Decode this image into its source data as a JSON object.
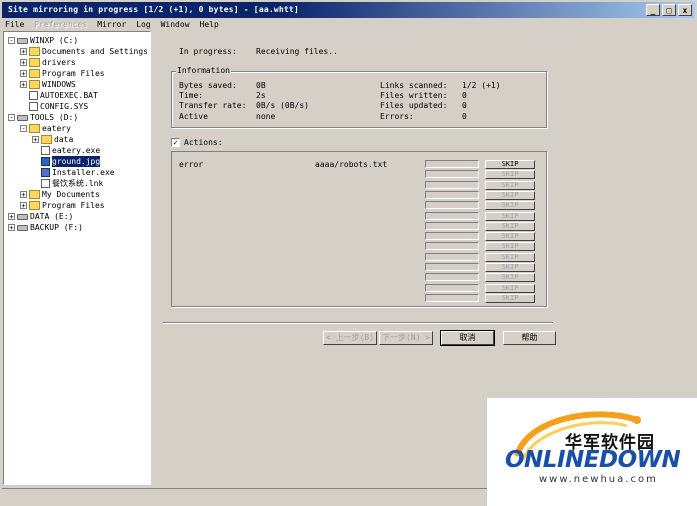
{
  "window": {
    "title": "Site mirroring in progress [1/2 (+1), 0 bytes] - [aa.whtt]",
    "buttons": {
      "minimize": "_",
      "maximize": "□",
      "close": "x"
    }
  },
  "menu": [
    {
      "label": "File",
      "disabled": false
    },
    {
      "label": "Preferences",
      "disabled": true
    },
    {
      "label": "Mirror",
      "disabled": false
    },
    {
      "label": "Log",
      "disabled": false
    },
    {
      "label": "Window",
      "disabled": false
    },
    {
      "label": "Help",
      "disabled": false
    }
  ],
  "tree": [
    {
      "label": "WINXP (C:)",
      "expander": "-",
      "icon": "drive-icon"
    },
    {
      "label": "Documents and Settings",
      "expander": "+",
      "icon": "folder-icon"
    },
    {
      "label": "drivers",
      "expander": "+",
      "icon": "folder-icon"
    },
    {
      "label": "Program Files",
      "expander": "+",
      "icon": "folder-icon"
    },
    {
      "label": "WINDOWS",
      "expander": "+",
      "icon": "folder-icon"
    },
    {
      "label": "AUTOEXEC.BAT",
      "expander": "",
      "icon": "file-icon"
    },
    {
      "label": "CONFIG.SYS",
      "expander": "",
      "icon": "file-icon"
    },
    {
      "label": "TOOLS (D:)",
      "expander": "-",
      "icon": "drive-icon"
    },
    {
      "label": "eatery",
      "expander": "-",
      "icon": "folder-icon"
    },
    {
      "label": "data",
      "expander": "+",
      "icon": "folder-icon"
    },
    {
      "label": "eatery.exe",
      "expander": "",
      "icon": "file-icon"
    },
    {
      "label": "ground.jpg",
      "expander": "",
      "icon": "image-icon"
    },
    {
      "label": "Installer.exe",
      "expander": "",
      "icon": "exe-icon"
    },
    {
      "label": "餐饮系统.lnk",
      "expander": "",
      "icon": "file-icon"
    },
    {
      "label": "My Documents",
      "expander": "+",
      "icon": "folder-icon"
    },
    {
      "label": "Program Files",
      "expander": "+",
      "icon": "folder-icon"
    },
    {
      "label": "DATA (E:)",
      "expander": "+",
      "icon": "drive-icon"
    },
    {
      "label": "BACKUP (F:)",
      "expander": "+",
      "icon": "drive-icon"
    }
  ],
  "progress": {
    "label": "In progress:",
    "value": "Receiving files.."
  },
  "information": {
    "title": "Information",
    "left": [
      {
        "label": "Bytes saved:",
        "value": "0B"
      },
      {
        "label": "Time:",
        "value": "2s"
      },
      {
        "label": "Transfer rate:",
        "value": "0B/s (0B/s)"
      },
      {
        "label": "Active",
        "value": "none"
      }
    ],
    "right": [
      {
        "label": "Links scanned:",
        "value": "1/2 (+1)"
      },
      {
        "label": "Files written:",
        "value": "0"
      },
      {
        "label": "Files updated:",
        "value": "0"
      },
      {
        "label": "Errors:",
        "value": "0"
      }
    ]
  },
  "actions": {
    "label": "Actions:",
    "checked": true,
    "row0": {
      "status": "error",
      "file": "aaaa/robots.txt"
    },
    "skip_label": "SKIP",
    "rows": 14
  },
  "buttons": {
    "back": "< 上一步(B)",
    "next": "下一步(N) >",
    "cancel": "取消",
    "help": "帮助"
  },
  "watermark": {
    "cn": "华军软件园",
    "brand": "ONLINEDOWN",
    "url": "www.newhua.com"
  }
}
